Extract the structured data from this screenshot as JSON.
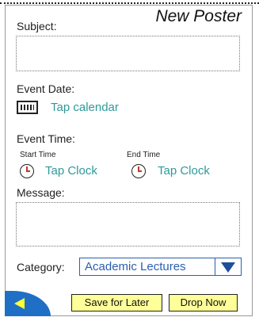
{
  "header": {
    "title": "New Poster"
  },
  "form": {
    "subject_label": "Subject:",
    "event_date_label": "Event Date:",
    "calendar_link": "Tap calendar",
    "event_time_label": "Event Time:",
    "start_time_label": "Start Time",
    "end_time_label": "End Time",
    "start_clock_link": "Tap Clock",
    "end_clock_link": "Tap Clock",
    "message_label": "Message:",
    "category_label": "Category:",
    "category_value": "Academic Lectures"
  },
  "actions": {
    "save_label": "Save for Later",
    "drop_label": "Drop Now"
  },
  "icons": {
    "calendar": "calendar-icon",
    "clock": "clock-icon",
    "dropdown": "chevron-down-icon",
    "back": "back-arrow-icon"
  },
  "colors": {
    "link": "#2f9a9a",
    "select_accent": "#2a5fb0",
    "button_bg": "#ffff99",
    "back_bg": "#1f6fc7",
    "back_arrow": "#ffff33"
  }
}
